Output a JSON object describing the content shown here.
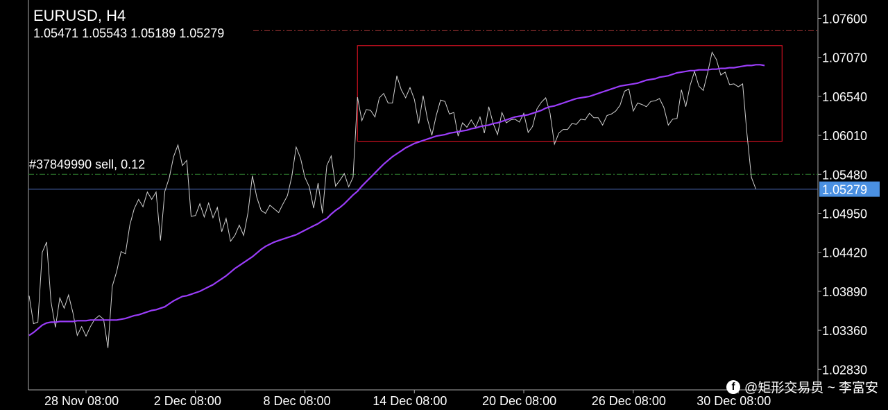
{
  "header": {
    "symbol": "EURUSD, H4",
    "ohlc": "1.05471 1.05543 1.05189 1.05279"
  },
  "order": {
    "label": "#37849990 sell, 0.12",
    "price": 1.0548
  },
  "watermark": {
    "text": "@矩形交易员 ~ 李富安",
    "icon": "facebook-icon"
  },
  "colors": {
    "background": "#000000",
    "price_line": "#d0d0d0",
    "ma_line": "#9b3dfa",
    "box": "#d01020",
    "bid_line": "#5577cc",
    "order_line": "#2f7d2f",
    "high_line": "#b03a3a",
    "price_tag": "#4a90e2"
  },
  "chart_data": {
    "type": "line",
    "title": "EURUSD, H4",
    "ylim": [
      1.0255,
      1.0785
    ],
    "y_ticks": [
      "1.07600",
      "1.07070",
      "1.06540",
      "1.06010",
      "1.05480",
      "1.04950",
      "1.04420",
      "1.03890",
      "1.03360",
      "1.02830"
    ],
    "x_ticks": [
      "28 Nov 08:00",
      "2 Dec 08:00",
      "8 Dec 08:00",
      "14 Dec 08:00",
      "20 Dec 08:00",
      "26 Dec 08:00",
      "30 Dec 08:00"
    ],
    "current_price": "1.05279",
    "high_level": 1.0744,
    "series": [
      {
        "kind": "price",
        "values": [
          1.0383,
          1.0345,
          1.0347,
          1.0442,
          1.0456,
          1.0375,
          1.034,
          1.038,
          1.0366,
          1.0384,
          1.036,
          1.0329,
          1.0341,
          1.0328,
          1.0341,
          1.0351,
          1.0356,
          1.0351,
          1.0312,
          1.0396,
          1.0416,
          1.0443,
          1.044,
          1.0479,
          1.0501,
          1.0514,
          1.0504,
          1.0524,
          1.0514,
          1.0524,
          1.0458,
          1.0525,
          1.0543,
          1.0572,
          1.0588,
          1.056,
          1.0567,
          1.0491,
          1.0492,
          1.0508,
          1.049,
          1.0509,
          1.0489,
          1.0503,
          1.047,
          1.0488,
          1.0457,
          1.0465,
          1.0479,
          1.0465,
          1.0496,
          1.0546,
          1.0517,
          1.0499,
          1.0495,
          1.0506,
          1.0501,
          1.0496,
          1.0508,
          1.0519,
          1.0545,
          1.0585,
          1.057,
          1.0544,
          1.0531,
          1.0502,
          1.0536,
          1.0495,
          1.056,
          1.0573,
          1.0532,
          1.054,
          1.0549,
          1.0531,
          1.0544,
          1.0653,
          1.0621,
          1.0636,
          1.0635,
          1.0626,
          1.0652,
          1.0658,
          1.0645,
          1.0645,
          1.0682,
          1.0663,
          1.0652,
          1.0666,
          1.065,
          1.0617,
          1.0655,
          1.0623,
          1.0601,
          1.0628,
          1.0649,
          1.0647,
          1.063,
          1.0632,
          1.06,
          1.0618,
          1.0612,
          1.0622,
          1.0612,
          1.0626,
          1.0604,
          1.064,
          1.0617,
          1.0602,
          1.0632,
          1.0618,
          1.0622,
          1.0623,
          1.0619,
          1.0631,
          1.0605,
          1.0613,
          1.0637,
          1.0646,
          1.0652,
          1.0631,
          1.0589,
          1.0604,
          1.0609,
          1.0609,
          1.0617,
          1.0616,
          1.0623,
          1.0622,
          1.0631,
          1.0625,
          1.0625,
          1.0615,
          1.0628,
          1.063,
          1.0634,
          1.0642,
          1.0661,
          1.0664,
          1.0634,
          1.0645,
          1.0643,
          1.064,
          1.0647,
          1.0648,
          1.0651,
          1.0639,
          1.0615,
          1.0623,
          1.0624,
          1.0663,
          1.064,
          1.0669,
          1.0688,
          1.0668,
          1.0662,
          1.0686,
          1.0714,
          1.0704,
          1.0683,
          1.0687,
          1.067,
          1.0671,
          1.0667,
          1.0671,
          1.0602,
          1.0544,
          1.0528
        ]
      },
      {
        "kind": "moving-average",
        "values": [
          1.0329,
          1.0333,
          1.0338,
          1.0343,
          1.0346,
          1.0347,
          1.0347,
          1.0348,
          1.0348,
          1.0348,
          1.0348,
          1.0349,
          1.0349,
          1.0349,
          1.035,
          1.035,
          1.035,
          1.035,
          1.035,
          1.035,
          1.035,
          1.0351,
          1.0352,
          1.0354,
          1.0356,
          1.0357,
          1.0359,
          1.0361,
          1.0363,
          1.0364,
          1.0366,
          1.0368,
          1.0372,
          1.0376,
          1.0379,
          1.0382,
          1.0383,
          1.0385,
          1.0387,
          1.0389,
          1.0392,
          1.0395,
          1.0398,
          1.0402,
          1.0406,
          1.041,
          1.0415,
          1.042,
          1.0424,
          1.0428,
          1.0432,
          1.0436,
          1.0441,
          1.0446,
          1.045,
          1.0453,
          1.0456,
          1.0458,
          1.046,
          1.0462,
          1.0464,
          1.0466,
          1.0469,
          1.0472,
          1.0475,
          1.0478,
          1.0481,
          1.0485,
          1.0488,
          1.0494,
          1.0499,
          1.0503,
          1.0508,
          1.0514,
          1.052,
          1.0525,
          1.0532,
          1.0538,
          1.0544,
          1.055,
          1.0556,
          1.0562,
          1.0567,
          1.0572,
          1.0576,
          1.058,
          1.0584,
          1.0587,
          1.059,
          1.0592,
          1.0594,
          1.0596,
          1.0598,
          1.06,
          1.0601,
          1.0602,
          1.0604,
          1.0605,
          1.0606,
          1.0607,
          1.0608,
          1.061,
          1.0611,
          1.0613,
          1.0614,
          1.0615,
          1.0617,
          1.0618,
          1.062,
          1.0622,
          1.0624,
          1.0626,
          1.0627,
          1.0628,
          1.0629,
          1.0631,
          1.0633,
          1.0635,
          1.0638,
          1.064,
          1.0641,
          1.0643,
          1.0645,
          1.0647,
          1.0649,
          1.0651,
          1.0652,
          1.0653,
          1.0654,
          1.0656,
          1.0658,
          1.066,
          1.0662,
          1.0664,
          1.0666,
          1.0668,
          1.0669,
          1.067,
          1.0671,
          1.0672,
          1.0674,
          1.0676,
          1.0677,
          1.0678,
          1.068,
          1.0681,
          1.0682,
          1.0684,
          1.0686,
          1.0687,
          1.0688,
          1.0689,
          1.0689,
          1.069,
          1.069,
          1.069,
          1.0691,
          1.0691,
          1.0692,
          1.0692,
          1.0693,
          1.0693,
          1.0694,
          1.0695,
          1.0696,
          1.0696,
          1.0697,
          1.0697,
          1.0696
        ]
      }
    ],
    "box": {
      "x_start_index": 75,
      "x_end_index": 172,
      "y_range": [
        1.0593,
        1.0723
      ]
    }
  }
}
